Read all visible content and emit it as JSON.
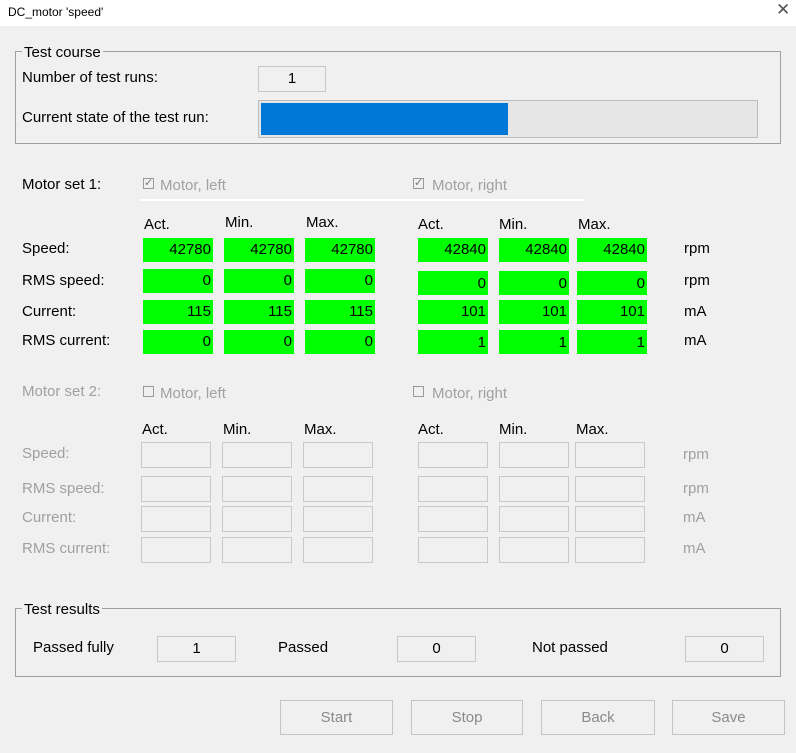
{
  "window": {
    "title": "DC_motor 'speed'",
    "close_glyph": "✕"
  },
  "test_course": {
    "legend": "Test course",
    "runs_label": "Number of test runs:",
    "runs_value": "1",
    "state_label": "Current state of the test run:",
    "progress_fraction": 0.5,
    "progress_color": "#0078d7"
  },
  "motor_set1": {
    "label": "Motor set 1:",
    "left_label": "Motor, left",
    "right_label": "Motor, right",
    "left_checked": true,
    "right_checked": true,
    "headers": [
      "Act.",
      "Min.",
      "Max."
    ],
    "rows": [
      {
        "label": "Speed:",
        "left": [
          "42780",
          "42780",
          "42780"
        ],
        "right": [
          "42840",
          "42840",
          "42840"
        ],
        "unit": "rpm"
      },
      {
        "label": "RMS speed:",
        "left": [
          "0",
          "0",
          "0"
        ],
        "right": [
          "0",
          "0",
          "0"
        ],
        "unit": "rpm"
      },
      {
        "label": "Current:",
        "left": [
          "115",
          "115",
          "115"
        ],
        "right": [
          "101",
          "101",
          "101"
        ],
        "unit": "mA"
      },
      {
        "label": "RMS current:",
        "left": [
          "0",
          "0",
          "0"
        ],
        "right": [
          "1",
          "1",
          "1"
        ],
        "unit": "mA"
      }
    ],
    "value_color": "#00ff00"
  },
  "motor_set2": {
    "label": "Motor set 2:",
    "left_label": "Motor, left",
    "right_label": "Motor, right",
    "left_checked": false,
    "right_checked": false,
    "headers": [
      "Act.",
      "Min.",
      "Max."
    ],
    "rows": [
      {
        "label": "Speed:",
        "unit": "rpm"
      },
      {
        "label": "RMS speed:",
        "unit": "rpm"
      },
      {
        "label": "Current:",
        "unit": "mA"
      },
      {
        "label": "RMS current:",
        "unit": "mA"
      }
    ]
  },
  "test_results": {
    "legend": "Test results",
    "passed_fully_label": "Passed fully",
    "passed_fully_value": "1",
    "passed_label": "Passed",
    "passed_value": "0",
    "not_passed_label": "Not passed",
    "not_passed_value": "0"
  },
  "buttons": {
    "start": "Start",
    "stop": "Stop",
    "back": "Back",
    "save": "Save"
  }
}
